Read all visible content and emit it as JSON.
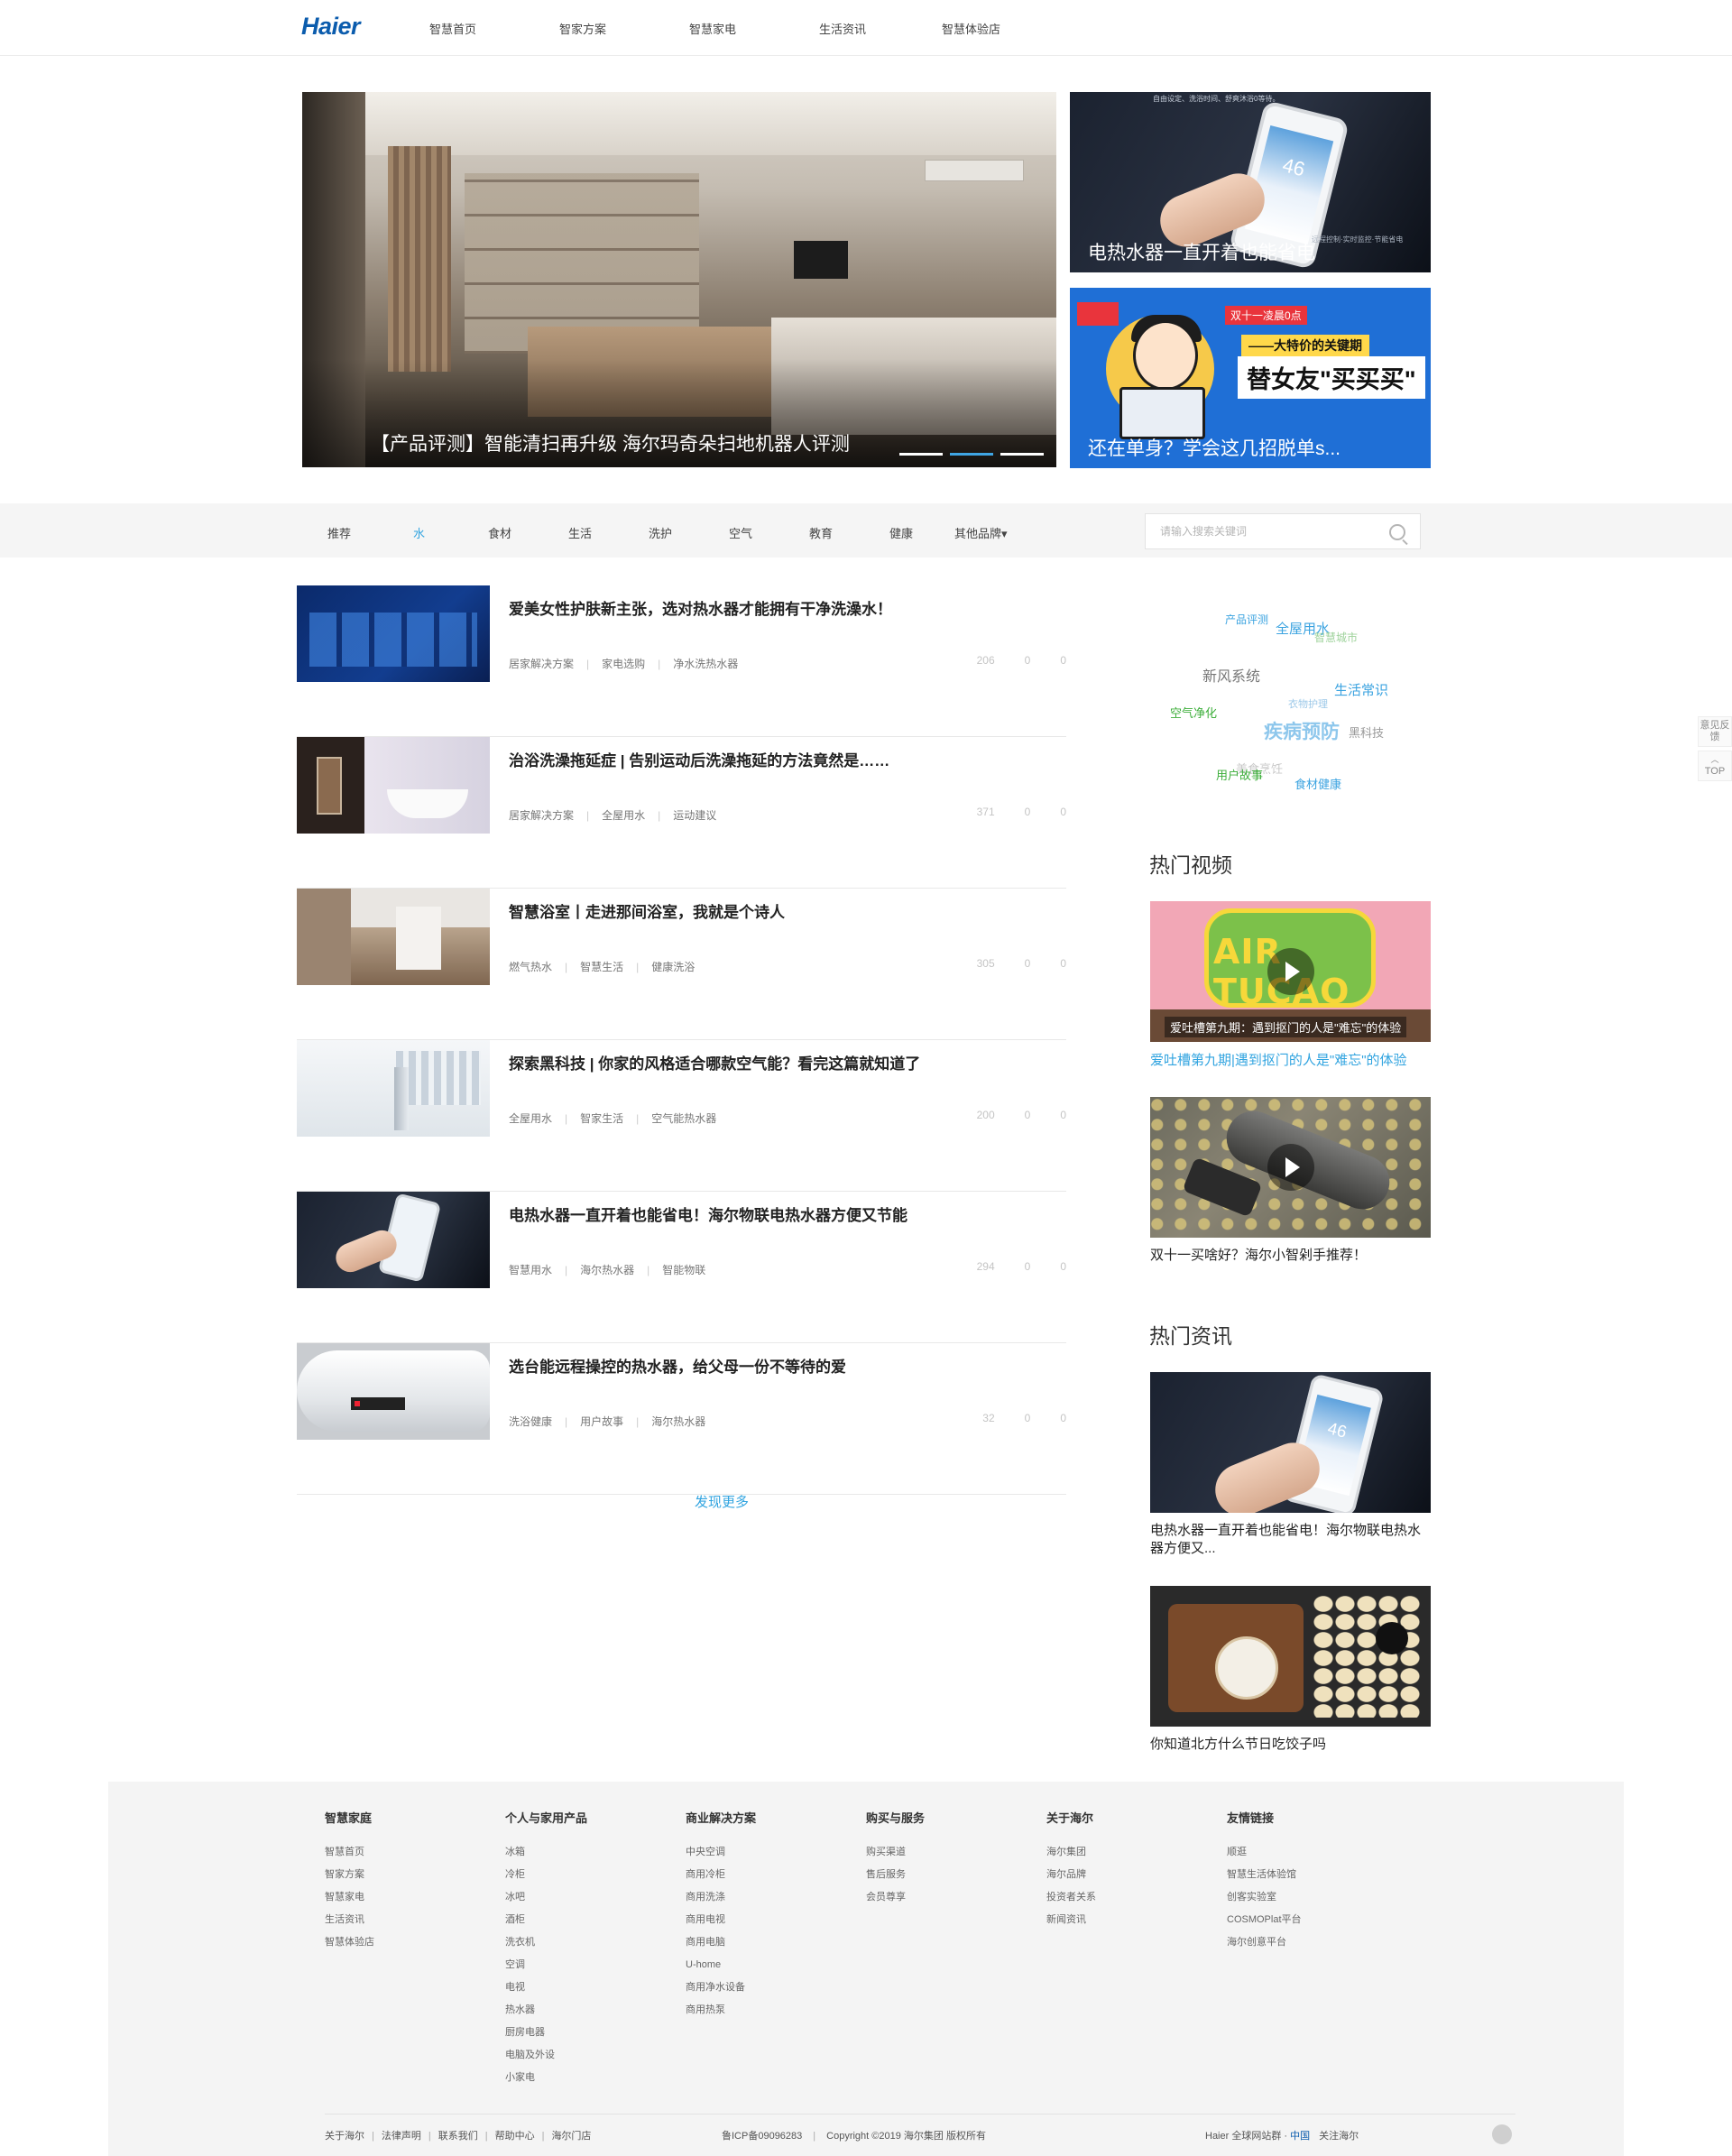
{
  "header": {
    "logo": "Haier",
    "nav": [
      "智慧首页",
      "智家方案",
      "智慧家电",
      "生活资讯",
      "智慧体验店"
    ]
  },
  "hero": {
    "main_caption": "【产品评测】智能清扫再升级 海尔玛奇朵扫地机器人评测",
    "slides_count": 3,
    "active_slide": 2,
    "side1": {
      "caption": "电热水器一直开着也能省电",
      "top_text": "自由设定、洗浴时间、舒爽沐浴0等待。",
      "phone_value": "46",
      "bottom_text": "远程控制·实时监控·节能省电"
    },
    "side2": {
      "caption": "还在单身？学会这几招脱单s...",
      "tag1": "双十一凌晨0点",
      "tag2": "——大特价的关键期",
      "tag3": "替女友\"买买买\""
    }
  },
  "tabs": {
    "items": [
      "推荐",
      "水",
      "食材",
      "生活",
      "洗护",
      "空气",
      "教育",
      "健康",
      "其他品牌▾"
    ],
    "active_index": 1
  },
  "search": {
    "placeholder": "请输入搜索关键词"
  },
  "articles": [
    {
      "title": "爱美女性护肤新主张，选对热水器才能拥有干净洗澡水！",
      "tags": [
        "居家解决方案",
        "家电选购",
        "净水洗热水器"
      ],
      "views": "206",
      "likes": "0",
      "comments": "0"
    },
    {
      "title": "治浴洗澡拖延症 | 告别运动后洗澡拖延的方法竟然是……",
      "tags": [
        "居家解决方案",
        "全屋用水",
        "运动建议"
      ],
      "views": "371",
      "likes": "0",
      "comments": "0"
    },
    {
      "title": "智慧浴室丨走进那间浴室，我就是个诗人",
      "tags": [
        "燃气热水",
        "智慧生活",
        "健康洗浴"
      ],
      "views": "305",
      "likes": "0",
      "comments": "0"
    },
    {
      "title": "探索黑科技 | 你家的风格适合哪款空气能？看完这篇就知道了",
      "tags": [
        "全屋用水",
        "智家生活",
        "空气能热水器"
      ],
      "views": "200",
      "likes": "0",
      "comments": "0"
    },
    {
      "title": "电热水器一直开着也能省电！海尔物联电热水器方便又节能",
      "tags": [
        "智慧用水",
        "海尔热水器",
        "智能物联"
      ],
      "views": "294",
      "likes": "0",
      "comments": "0"
    },
    {
      "title": "选台能远程操控的热水器，给父母一份不等待的爱",
      "tags": [
        "洗浴健康",
        "用户故事",
        "海尔热水器"
      ],
      "views": "32",
      "likes": "0",
      "comments": "0"
    }
  ],
  "more_link": "发现更多",
  "tag_cloud": [
    {
      "text": "产品评测",
      "color": "#3ba3e0"
    },
    {
      "text": "全屋用水",
      "color": "#3ba3e0"
    },
    {
      "text": "智慧城市",
      "color": "#9fd39c"
    },
    {
      "text": "新风系统",
      "color": "#777777"
    },
    {
      "text": "生活常识",
      "color": "#3ba3e0"
    },
    {
      "text": "衣物护理",
      "color": "#9cc8e8"
    },
    {
      "text": "空气净化",
      "color": "#3cae3a"
    },
    {
      "text": "疾病预防",
      "color": "#8ec7ec"
    },
    {
      "text": "黑科技",
      "color": "#999999"
    },
    {
      "text": "美食烹饪",
      "color": "#c9c9c9"
    },
    {
      "text": "用户故事",
      "color": "#3cae3a"
    },
    {
      "text": "食材健康",
      "color": "#3ba3e0"
    }
  ],
  "hot_videos": {
    "title": "热门视频",
    "items": [
      {
        "title": "爱吐槽第九期|遇到抠门的人是\"难忘\"的体验",
        "banner": "爱吐槽第九期：遇到抠门的人是\"难忘\"的体验",
        "logo": "AIR TUCAO",
        "highlighted": true
      },
      {
        "title": "双十一买啥好？海尔小智剁手推荐！",
        "highlighted": false
      }
    ]
  },
  "hot_news": {
    "title": "热门资讯",
    "items": [
      {
        "title": "电热水器一直开着也能省电！海尔物联电热水器方便又...",
        "phone_value": "46"
      },
      {
        "title": "你知道北方什么节日吃饺子吗"
      }
    ]
  },
  "feedback": {
    "label": "意见反馈",
    "top": "TOP"
  },
  "footer": {
    "columns": [
      {
        "title": "智慧家庭",
        "links": [
          "智慧首页",
          "智家方案",
          "智慧家电",
          "生活资讯",
          "智慧体验店"
        ]
      },
      {
        "title": "个人与家用产品",
        "links": [
          "冰箱",
          "冷柜",
          "冰吧",
          "酒柜",
          "洗衣机",
          "空调",
          "电视",
          "热水器",
          "厨房电器",
          "电脑及外设",
          "小家电"
        ]
      },
      {
        "title": "商业解决方案",
        "links": [
          "中央空调",
          "商用冷柜",
          "商用洗涤",
          "商用电视",
          "商用电脑",
          "U-home",
          "商用净水设备",
          "商用热泵"
        ]
      },
      {
        "title": "购买与服务",
        "links": [
          "购买渠道",
          "售后服务",
          "会员尊享"
        ]
      },
      {
        "title": "关于海尔",
        "links": [
          "海尔集团",
          "海尔品牌",
          "投资者关系",
          "新闻资讯"
        ]
      },
      {
        "title": "友情链接",
        "links": [
          "顺逛",
          "智慧生活体验馆",
          "创客实验室",
          "COSMOPlat平台",
          "海尔创意平台"
        ]
      }
    ],
    "bottom_links": [
      "关于海尔",
      "法律声明",
      "联系我们",
      "帮助中心",
      "海尔门店"
    ],
    "icp": "鲁ICP备09096283",
    "copyright": "Copyright ©2019 海尔集团 版权所有",
    "global_label": "Haier 全球网站群 · ",
    "region": "中国",
    "follow": "关注海尔"
  }
}
